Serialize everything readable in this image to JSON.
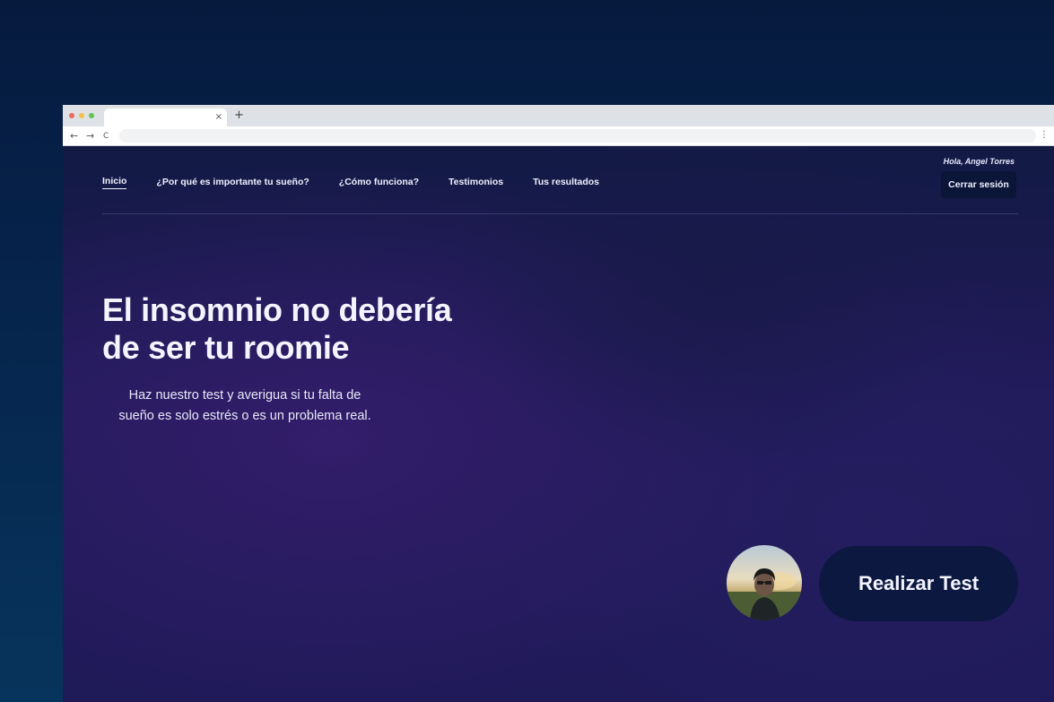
{
  "browser": {
    "window_controls": [
      "close",
      "minimize",
      "maximize"
    ],
    "control_colors": {
      "close": "#ed6a5e",
      "minimize": "#f5bf4f",
      "maximize": "#61c554"
    },
    "tab_title": "",
    "tab_close_symbol": "×",
    "new_tab_symbol": "+",
    "back_symbol": "←",
    "forward_symbol": "→",
    "reload_symbol": "C",
    "menu_symbol": "⋮",
    "address_value": ""
  },
  "nav": {
    "items": [
      {
        "label": "Inicio",
        "active": true
      },
      {
        "label": "¿Por qué es importante tu sueño?",
        "active": false
      },
      {
        "label": "¿Cómo funciona?",
        "active": false
      },
      {
        "label": "Testimonios",
        "active": false
      },
      {
        "label": "Tus resultados",
        "active": false
      }
    ]
  },
  "user": {
    "greeting": "Hola, Angel Torres",
    "logout_label": "Cerrar sesión"
  },
  "hero": {
    "title_line1": "El insomnio no debería",
    "title_line2": "de ser tu roomie",
    "subtitle_line1": "Haz nuestro test y averigua si tu falta de",
    "subtitle_line2": "sueño es solo estrés o es un problema real."
  },
  "cta": {
    "label": "Realizar Test"
  },
  "colors": {
    "outer_background": "#06224a",
    "page_background": "#221a5a",
    "button_background": "#0c1840",
    "text": "#f4f4ff"
  }
}
